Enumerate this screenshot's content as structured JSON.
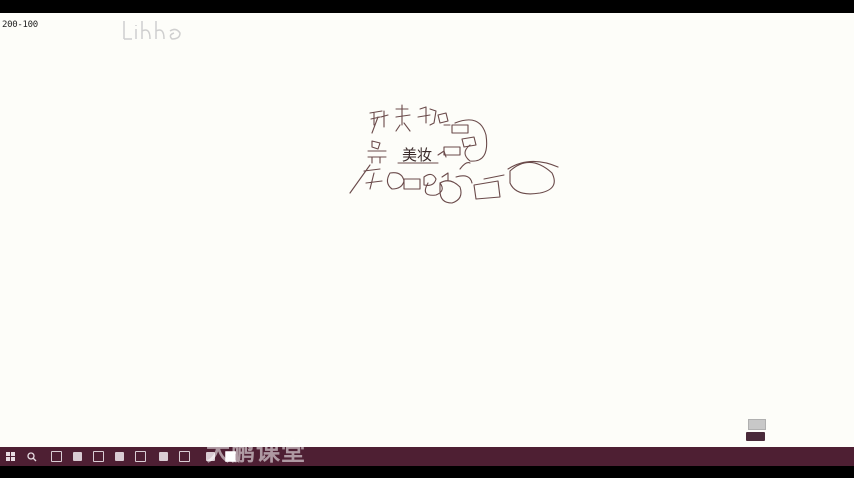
{
  "whiteboard": {
    "counter_text": "200-100",
    "center_word": "美妆"
  },
  "taskbar": {
    "watermark_text": "大鹏课堂",
    "clock_time": "",
    "clock_date": "",
    "icons": [
      "windows-start-icon",
      "search-icon",
      "task-view-icon",
      "app-icon",
      "app-icon",
      "app-icon",
      "app-icon",
      "app-icon",
      "app-icon",
      "app-icon",
      "app-icon",
      "app-icon",
      "app-icon",
      "app-icon"
    ]
  },
  "corner_widget": {
    "chip_label": ""
  },
  "colors": {
    "taskbar": "#4e1f33",
    "canvas": "#fdfdf9",
    "ink": "#5a4040"
  }
}
